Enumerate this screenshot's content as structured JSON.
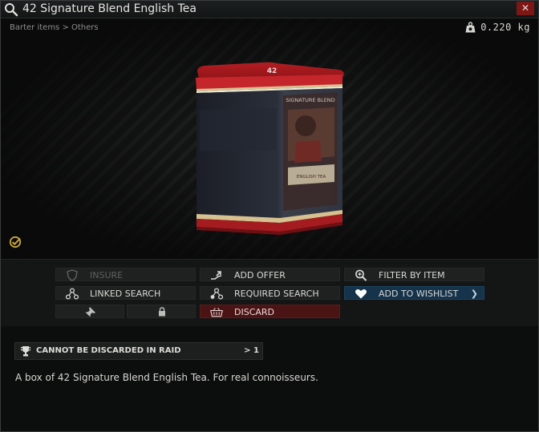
{
  "window": {
    "title": "42 Signature Blend English Tea",
    "close_symbol": "✕"
  },
  "header": {
    "breadcrumb": "Barter items > Others",
    "weight": "0.220 kg"
  },
  "item_image": {
    "tin_lid_label": "42",
    "tin_front_label": "SIGNATURE BLEND",
    "tin_lower_label": "ENGLISH TEA"
  },
  "actions": {
    "insure": "INSURE",
    "add_offer": "ADD OFFER",
    "filter_by_item": "FILTER BY ITEM",
    "linked_search": "LINKED SEARCH",
    "required_search": "REQUIRED SEARCH",
    "add_to_wishlist": "ADD TO WISHLIST",
    "discard": "DISCARD"
  },
  "discard_note": {
    "label": "CANNOT BE DISCARDED IN RAID",
    "count": "> 1"
  },
  "description": "A box of 42 Signature Blend English Tea. For real connoisseurs.",
  "colors": {
    "discard_bg": "#4b1414",
    "wishlist_bg": "#15334a",
    "close_bg": "#7d1716",
    "examined_check": "#c9a93a"
  }
}
